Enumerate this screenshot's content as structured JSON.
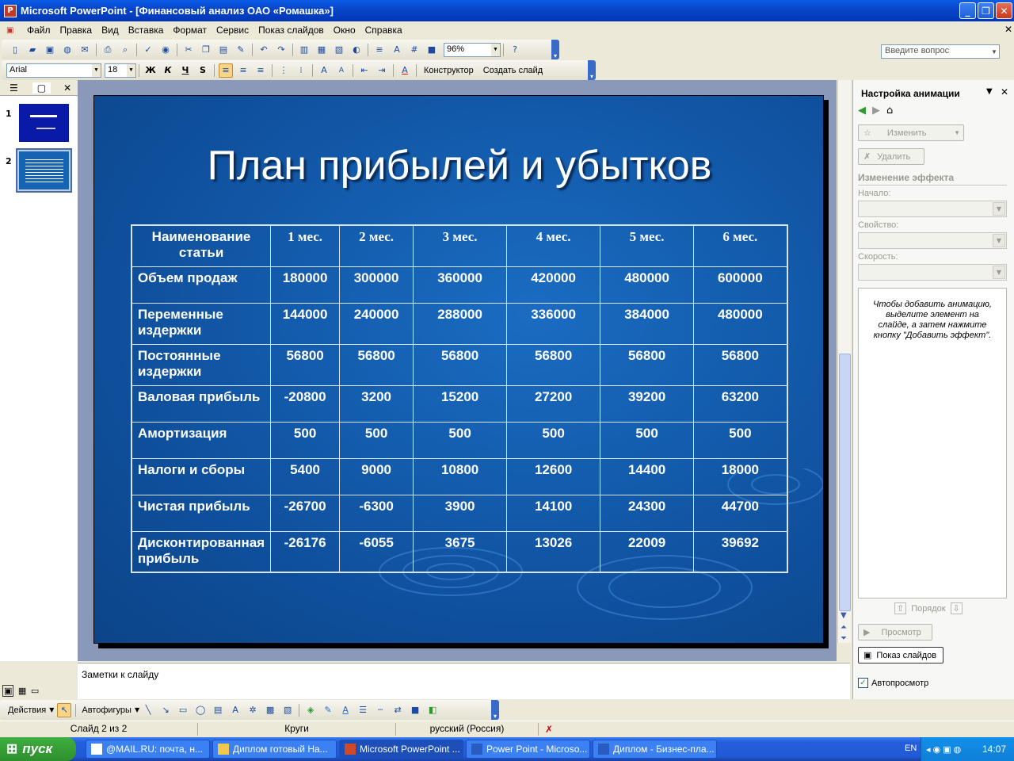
{
  "window": {
    "title": "Microsoft PowerPoint - [Финансовый анализ ОАО «Ромашка»]"
  },
  "menu": [
    "Файл",
    "Правка",
    "Вид",
    "Вставка",
    "Формат",
    "Сервис",
    "Показ слайдов",
    "Окно",
    "Справка"
  ],
  "ask_placeholder": "Введите вопрос",
  "toolbar": {
    "zoom": "96%",
    "font": "Arial",
    "font_size": "18",
    "designer_label": "Конструктор",
    "new_slide_label": "Создать слайд"
  },
  "slides_panel": {
    "numbers": [
      "1",
      "2"
    ]
  },
  "slide": {
    "title": "План прибылей и убытков",
    "table": {
      "headers": [
        "Наименование статьи",
        "1 мес.",
        "2 мес.",
        "3 мес.",
        "4 мес.",
        "5 мес.",
        "6 мес."
      ],
      "rows": [
        [
          "Объем продаж",
          "180000",
          "300000",
          "360000",
          "420000",
          "480000",
          "600000"
        ],
        [
          "Переменные издержки",
          "144000",
          "240000",
          "288000",
          "336000",
          "384000",
          "480000"
        ],
        [
          "Постоянные издержки",
          "56800",
          "56800",
          "56800",
          "56800",
          "56800",
          "56800"
        ],
        [
          "Валовая прибыль",
          "-20800",
          "3200",
          "15200",
          "27200",
          "39200",
          "63200"
        ],
        [
          "Амортизация",
          "500",
          "500",
          "500",
          "500",
          "500",
          "500"
        ],
        [
          "Налоги и сборы",
          "5400",
          "9000",
          "10800",
          "12600",
          "14400",
          "18000"
        ],
        [
          "Чистая прибыль",
          "-26700",
          "-6300",
          "3900",
          "14100",
          "24300",
          "44700"
        ],
        [
          "Дисконтированная прибыль",
          "-26176",
          "-6055",
          "3675",
          "13026",
          "22009",
          "39692"
        ]
      ]
    }
  },
  "notes_placeholder": "Заметки к слайду",
  "task_pane": {
    "title": "Настройка анимации",
    "change_button": "Изменить",
    "remove_button": "Удалить",
    "effect_header": "Изменение эффекта",
    "start_label": "Начало:",
    "property_label": "Свойство:",
    "speed_label": "Скорость:",
    "hint": "Чтобы добавить анимацию, выделите элемент на слайде, а затем нажмите кнопку \"Добавить эффект\".",
    "order_label": "Порядок",
    "preview_button": "Просмотр",
    "slideshow_button": "Показ слайдов",
    "autopreview_label": "Автопросмотр"
  },
  "drawing_toolbar": {
    "actions_label": "Действия",
    "autoshapes_label": "Автофигуры"
  },
  "status": {
    "slide_info": "Слайд 2 из 2",
    "design": "Круги",
    "language": "русский (Россия)"
  },
  "taskbar": {
    "start_label": "пуск",
    "tasks": [
      "@MAIL.RU: почта, н...",
      "Диплом готовый На...",
      "Microsoft PowerPoint ...",
      "Power Point - Microso...",
      "Диплом - Бизнес-пла..."
    ],
    "lang": "EN",
    "clock": "14:07"
  }
}
